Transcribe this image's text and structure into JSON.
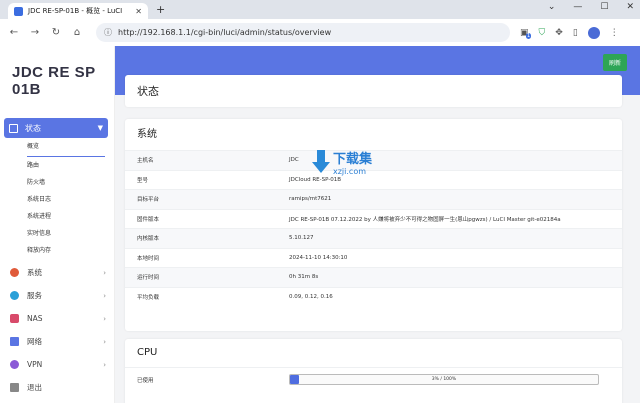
{
  "browser": {
    "tab_title": "JDC RE-SP-01B - 概览 - LuCI",
    "url": "http://192.168.1.1/cgi-bin/luci/admin/status/overview",
    "new_tab": "+",
    "badge": "1"
  },
  "sidebar": {
    "logo": "JDC RE SP 01B",
    "active_menu": "状态",
    "sub_items": [
      "概览",
      "路由",
      "防火墙",
      "系统日志",
      "系统进程",
      "实时信息",
      "释放内存"
    ],
    "items": [
      {
        "label": "系统",
        "icon": "gear-icon",
        "color": "#e05a3a"
      },
      {
        "label": "服务",
        "icon": "link-icon",
        "color": "#2aa0d8"
      },
      {
        "label": "NAS",
        "icon": "storage-icon",
        "color": "#d84a6a"
      },
      {
        "label": "网络",
        "icon": "network-icon",
        "color": "#5a75e3"
      },
      {
        "label": "VPN",
        "icon": "vpn-icon",
        "color": "#8b5ad6"
      },
      {
        "label": "退出",
        "icon": "logout-icon",
        "color": "#888888"
      }
    ]
  },
  "main": {
    "refresh_label": "刷新",
    "page_title": "状态",
    "system": {
      "title": "系统",
      "rows": [
        {
          "k": "主机名",
          "v": "JDC"
        },
        {
          "k": "型号",
          "v": "JDCloud RE-SP-01B"
        },
        {
          "k": "目标平台",
          "v": "ramips/mt7621"
        },
        {
          "k": "固件版本",
          "v": "JDC RE-SP-01B 07.12.2022 by 人嫌将被弃少不可得之物固屏一生(恩山pgwzs) / LuCI Master git-e02184a"
        },
        {
          "k": "内核版本",
          "v": "5.10.127"
        },
        {
          "k": "本地时间",
          "v": "2024-11-10 14:30:10"
        },
        {
          "k": "运行时间",
          "v": "0h 31m 8s"
        },
        {
          "k": "平均负载",
          "v": "0.09, 0.12, 0.16"
        }
      ]
    },
    "cpu": {
      "title": "CPU",
      "label": "已使用",
      "usage_text": "3% / 100%",
      "usage_percent": 3
    }
  },
  "watermark": {
    "text": "下载集",
    "sub": "xzji.com"
  },
  "colors": {
    "accent": "#5a75e3",
    "refresh": "#2ea556"
  }
}
